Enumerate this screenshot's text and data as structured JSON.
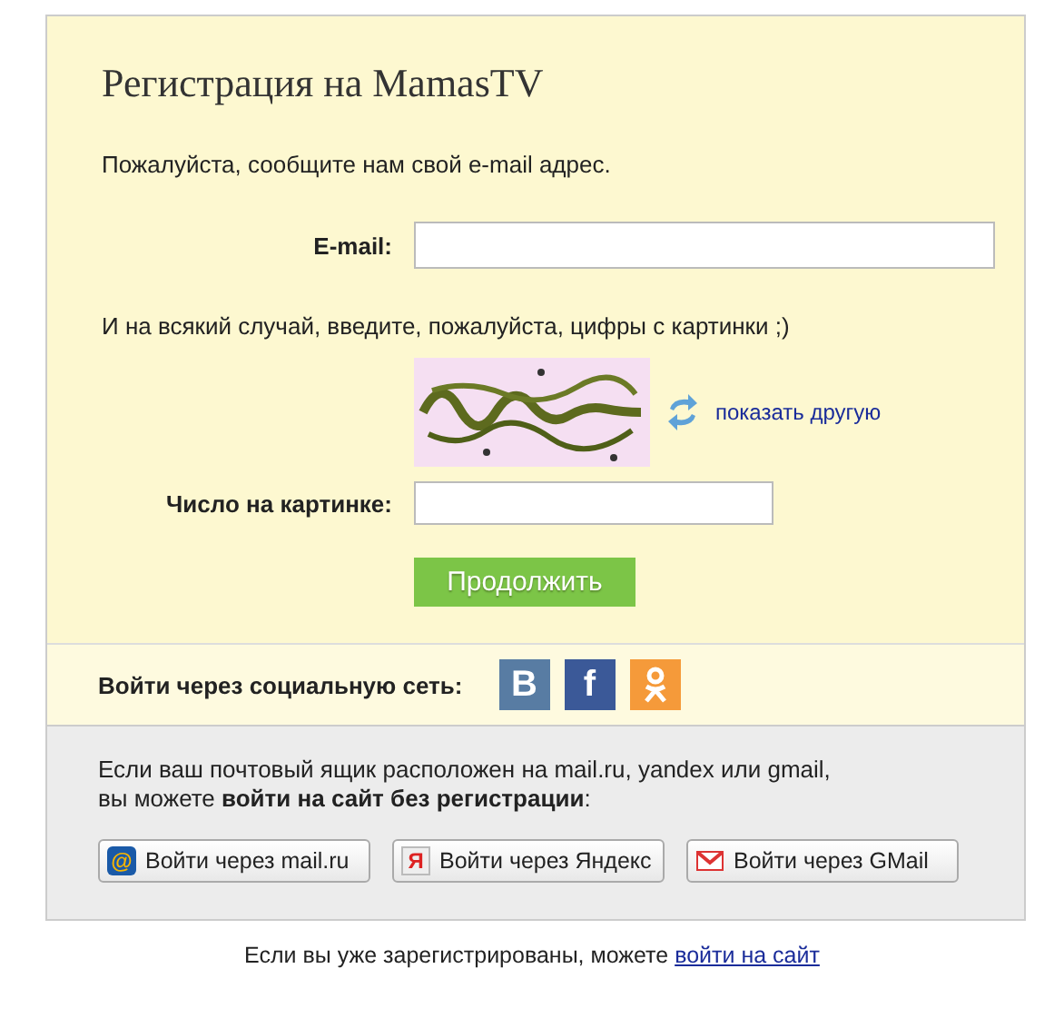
{
  "title": "Регистрация на MamasTV",
  "intro": "Пожалуйста, сообщите нам свой e-mail адрес.",
  "email": {
    "label": "E-mail:"
  },
  "captcha_hint": "И на всякий случай, введите, пожалуйста, цифры с картинки ;)",
  "captcha": {
    "kind": "picture",
    "refresh_link": "показать другую"
  },
  "number": {
    "label": "Число на картинке:"
  },
  "submit": "Продолжить",
  "social": {
    "label": "Войти через социальную сеть:",
    "networks": [
      {
        "kind": "vk",
        "glyph": "В",
        "color": "#587ca3"
      },
      {
        "kind": "fb",
        "glyph": "f",
        "color": "#3b5998"
      },
      {
        "kind": "ok",
        "color": "#f59a3a"
      }
    ]
  },
  "mail_note": "Если ваш почтовый ящик расположен на mail.ru, yandex или gmail,\nвы можете **войти на сайт без регистрации**:",
  "mail_buttons": [
    {
      "kind": "mailru",
      "glyph": "@",
      "label": "Войти через mail.ru"
    },
    {
      "kind": "yandex",
      "glyph": "Я",
      "label": "Войти через Яндекс"
    },
    {
      "kind": "gmail",
      "label": "Войти через GMail"
    }
  ],
  "footer": {
    "text": "Если вы уже зарегистрированы, можете",
    "link": "войти на сайт"
  }
}
